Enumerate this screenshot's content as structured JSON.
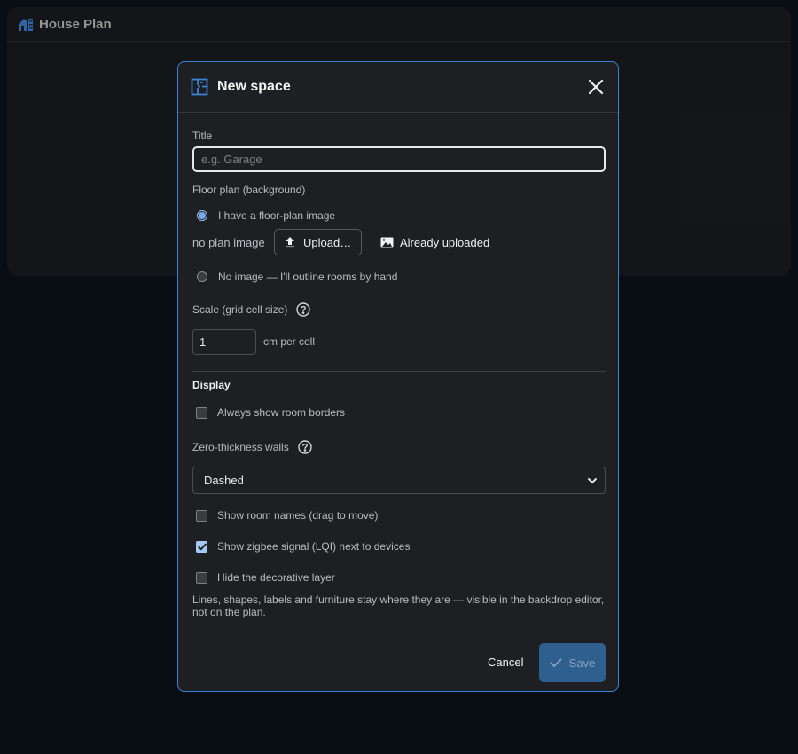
{
  "app": {
    "title": "House Plan"
  },
  "dialog": {
    "title": "New space",
    "title_field": {
      "label": "Title",
      "placeholder": "e.g. Garage",
      "value": ""
    },
    "floor_plan": {
      "label": "Floor plan (background)",
      "option_image": "I have a floor-plan image",
      "no_plan_text": "no plan image",
      "upload_label": "Upload…",
      "already_uploaded_label": "Already uploaded",
      "option_none": "No image — I'll outline rooms by hand",
      "selected": "image"
    },
    "scale": {
      "label": "Scale (grid cell size)",
      "value": "1",
      "unit": "cm per cell"
    },
    "display": {
      "heading": "Display",
      "always_borders": {
        "label": "Always show room borders",
        "checked": false
      },
      "walls_label": "Zero-thickness walls",
      "walls_value": "Dashed",
      "show_names": {
        "label": "Show room names (drag to move)",
        "checked": false
      },
      "show_lqi": {
        "label": "Show zigbee signal (LQI) next to devices",
        "checked": true
      },
      "hide_decor": {
        "label": "Hide the decorative layer",
        "checked": false
      },
      "hint": "Lines, shapes, labels and furniture stay where they are — visible in the backdrop editor, not on the plan."
    },
    "footer": {
      "cancel_label": "Cancel",
      "save_label": "Save"
    }
  },
  "colors": {
    "accent": "#3b82d6",
    "checkbox_on": "#a6c8f5",
    "save_bg": "#2e5f8f"
  }
}
